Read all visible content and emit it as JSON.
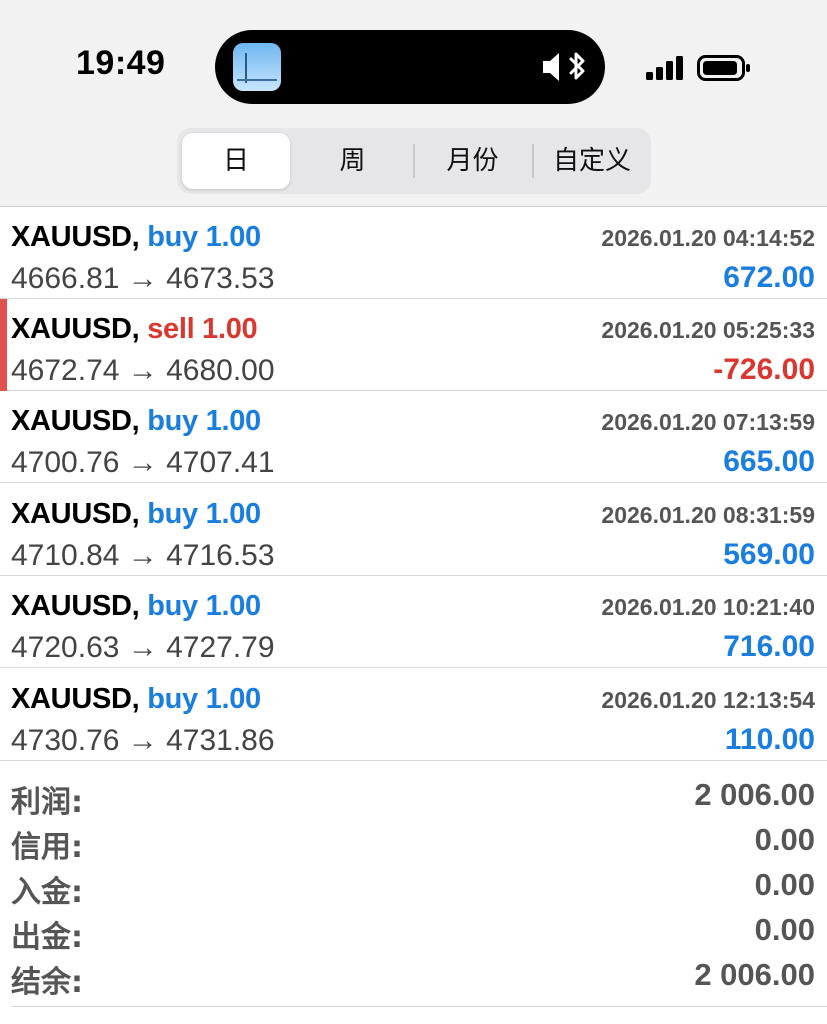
{
  "status_bar": {
    "time": "19:49",
    "icons": [
      "album-art-icon",
      "mute-icon",
      "bluetooth-icon",
      "signal-icon",
      "battery-icon"
    ]
  },
  "period_tabs": [
    {
      "label": "日",
      "active": true
    },
    {
      "label": "周",
      "active": false
    },
    {
      "label": "月份",
      "active": false
    },
    {
      "label": "自定义",
      "active": false
    }
  ],
  "colors": {
    "buy": "#1a7de0",
    "sell": "#d8382f",
    "positive": "#1a7de0",
    "negative": "#d8382f"
  },
  "trades": [
    {
      "symbol": "XAUUSD,",
      "side": "buy",
      "volume": "1.00",
      "time": "2026.01.20 04:14:52",
      "prices": "4666.81 → 4673.53",
      "profit": "672.00",
      "highlight": false
    },
    {
      "symbol": "XAUUSD,",
      "side": "sell",
      "volume": "1.00",
      "time": "2026.01.20 05:25:33",
      "prices": "4672.74 → 4680.00",
      "profit": "-726.00",
      "highlight": true
    },
    {
      "symbol": "XAUUSD,",
      "side": "buy",
      "volume": "1.00",
      "time": "2026.01.20 07:13:59",
      "prices": "4700.76 → 4707.41",
      "profit": "665.00",
      "highlight": false
    },
    {
      "symbol": "XAUUSD,",
      "side": "buy",
      "volume": "1.00",
      "time": "2026.01.20 08:31:59",
      "prices": "4710.84 → 4716.53",
      "profit": "569.00",
      "highlight": false
    },
    {
      "symbol": "XAUUSD,",
      "side": "buy",
      "volume": "1.00",
      "time": "2026.01.20 10:21:40",
      "prices": "4720.63 → 4727.79",
      "profit": "716.00",
      "highlight": false
    },
    {
      "symbol": "XAUUSD,",
      "side": "buy",
      "volume": "1.00",
      "time": "2026.01.20 12:13:54",
      "prices": "4730.76 → 4731.86",
      "profit": "110.00",
      "highlight": false
    }
  ],
  "summary": [
    {
      "label": "利润:",
      "value": "2 006.00"
    },
    {
      "label": "信用:",
      "value": "0.00"
    },
    {
      "label": "入金:",
      "value": "0.00"
    },
    {
      "label": "出金:",
      "value": "0.00"
    },
    {
      "label": "结余:",
      "value": "2 006.00"
    }
  ]
}
